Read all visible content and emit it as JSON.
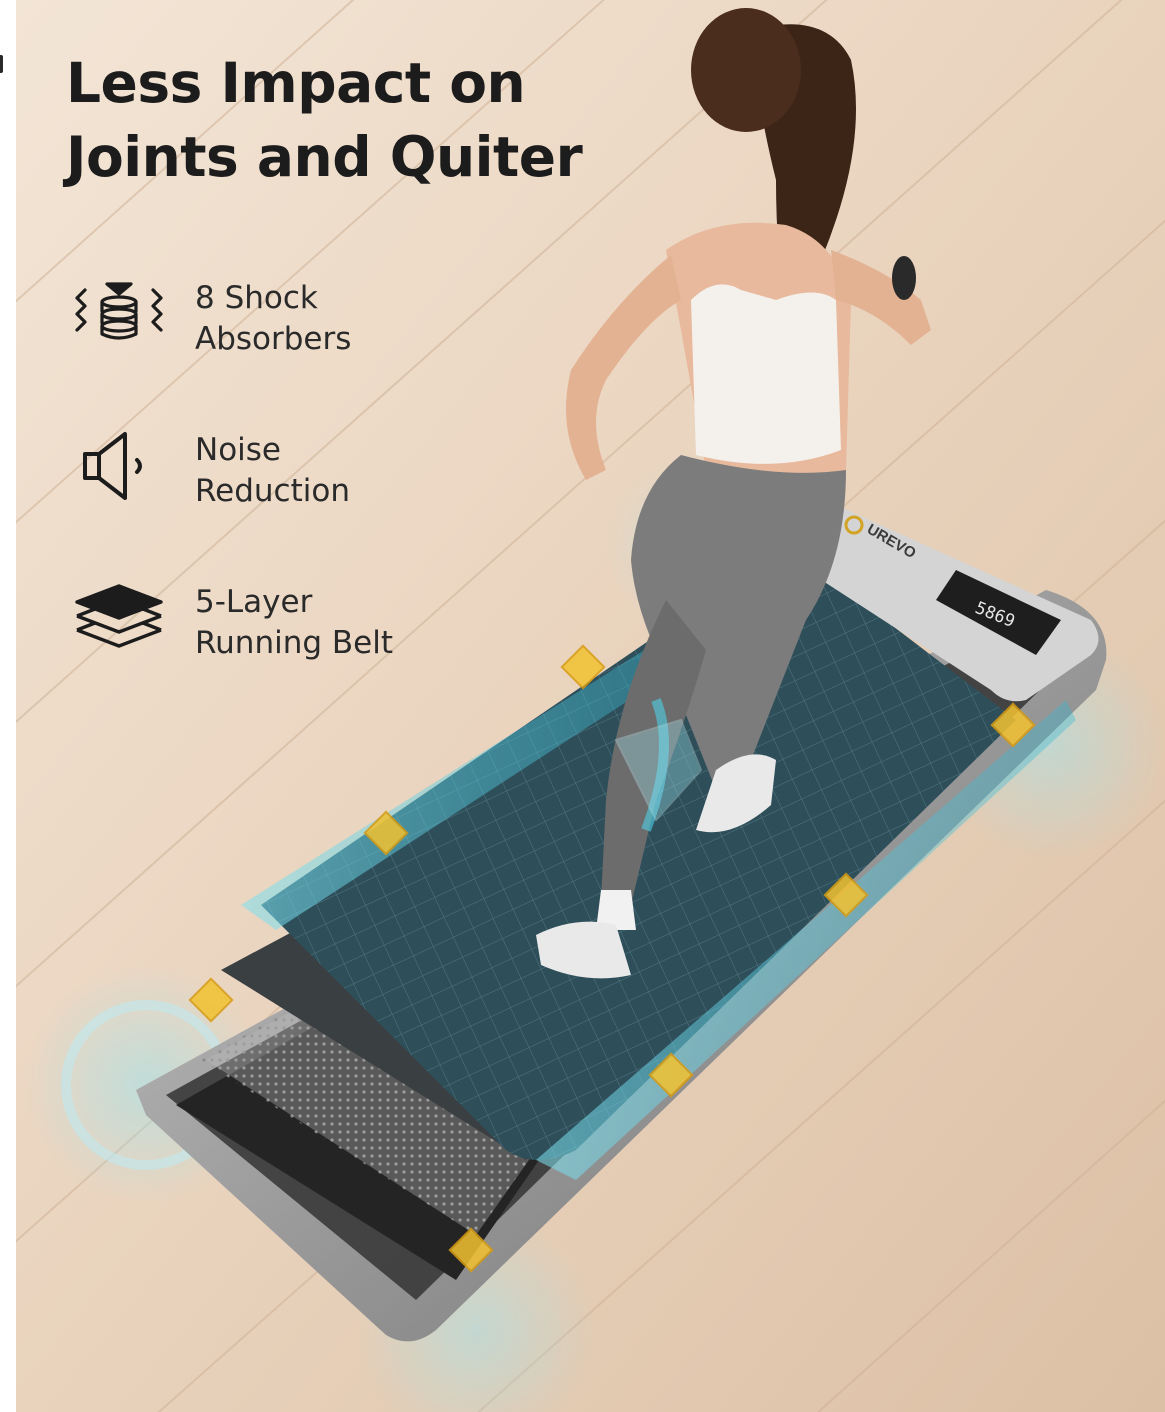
{
  "headline": {
    "line1": "Less Impact on",
    "line2": "Joints and Quiter"
  },
  "features": [
    {
      "icon": "shock-absorber-icon",
      "line1": "8 Shock",
      "line2": "Absorbers"
    },
    {
      "icon": "speaker-icon",
      "line1": "Noise",
      "line2": "Reduction"
    },
    {
      "icon": "layers-icon",
      "line1": "5-Layer",
      "line2": "Running Belt"
    }
  ],
  "product": {
    "brand": "UREVO",
    "display": "5869"
  },
  "colors": {
    "floor": "#e8d2bd",
    "text": "#1c1c1c",
    "belt": "#2e4f5a",
    "accent": "#4fd0e6",
    "absorber": "#f2c230"
  }
}
